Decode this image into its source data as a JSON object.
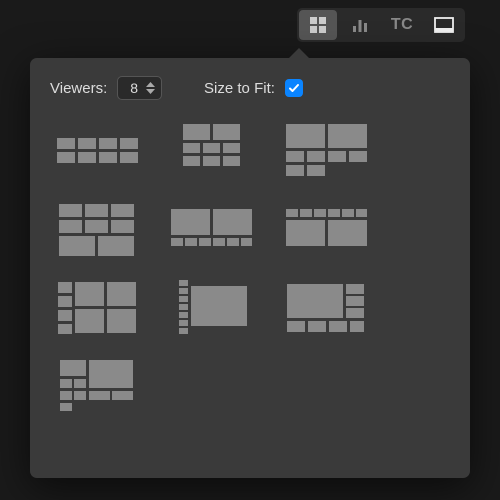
{
  "toolbar": {
    "grid_active": true,
    "tc_label": "TC"
  },
  "popover": {
    "viewers_label": "Viewers:",
    "viewers_value": "8",
    "size_to_fit_label": "Size to Fit:",
    "size_to_fit_checked": true
  }
}
